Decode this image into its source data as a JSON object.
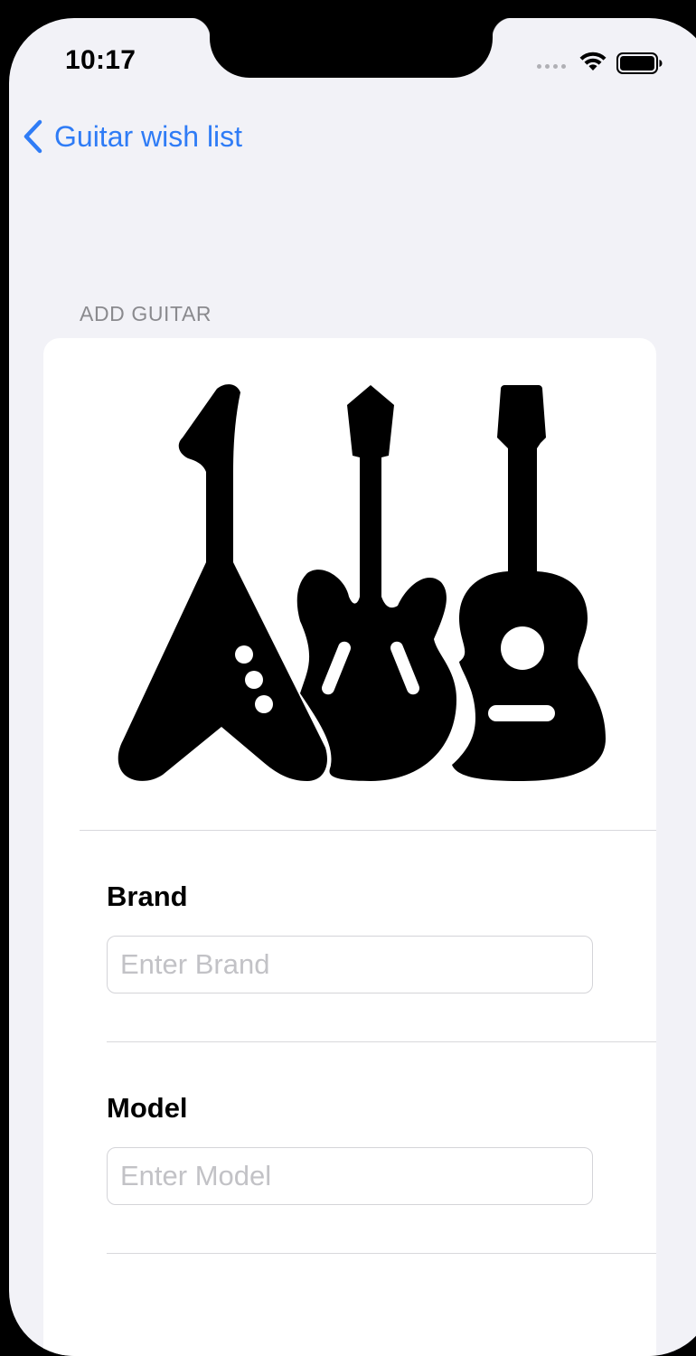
{
  "status_bar": {
    "time": "10:17"
  },
  "navigation": {
    "back_label": "Guitar wish list"
  },
  "form": {
    "section_header": "ADD GUITAR",
    "image_icon": "guitars-icon",
    "fields": [
      {
        "label": "Brand",
        "value": "",
        "placeholder": "Enter Brand"
      },
      {
        "label": "Model",
        "value": "",
        "placeholder": "Enter Model"
      }
    ]
  },
  "colors": {
    "accent": "#2f7cf6",
    "background": "#f2f2f7",
    "card": "#ffffff",
    "placeholder": "#c2c2c6"
  }
}
